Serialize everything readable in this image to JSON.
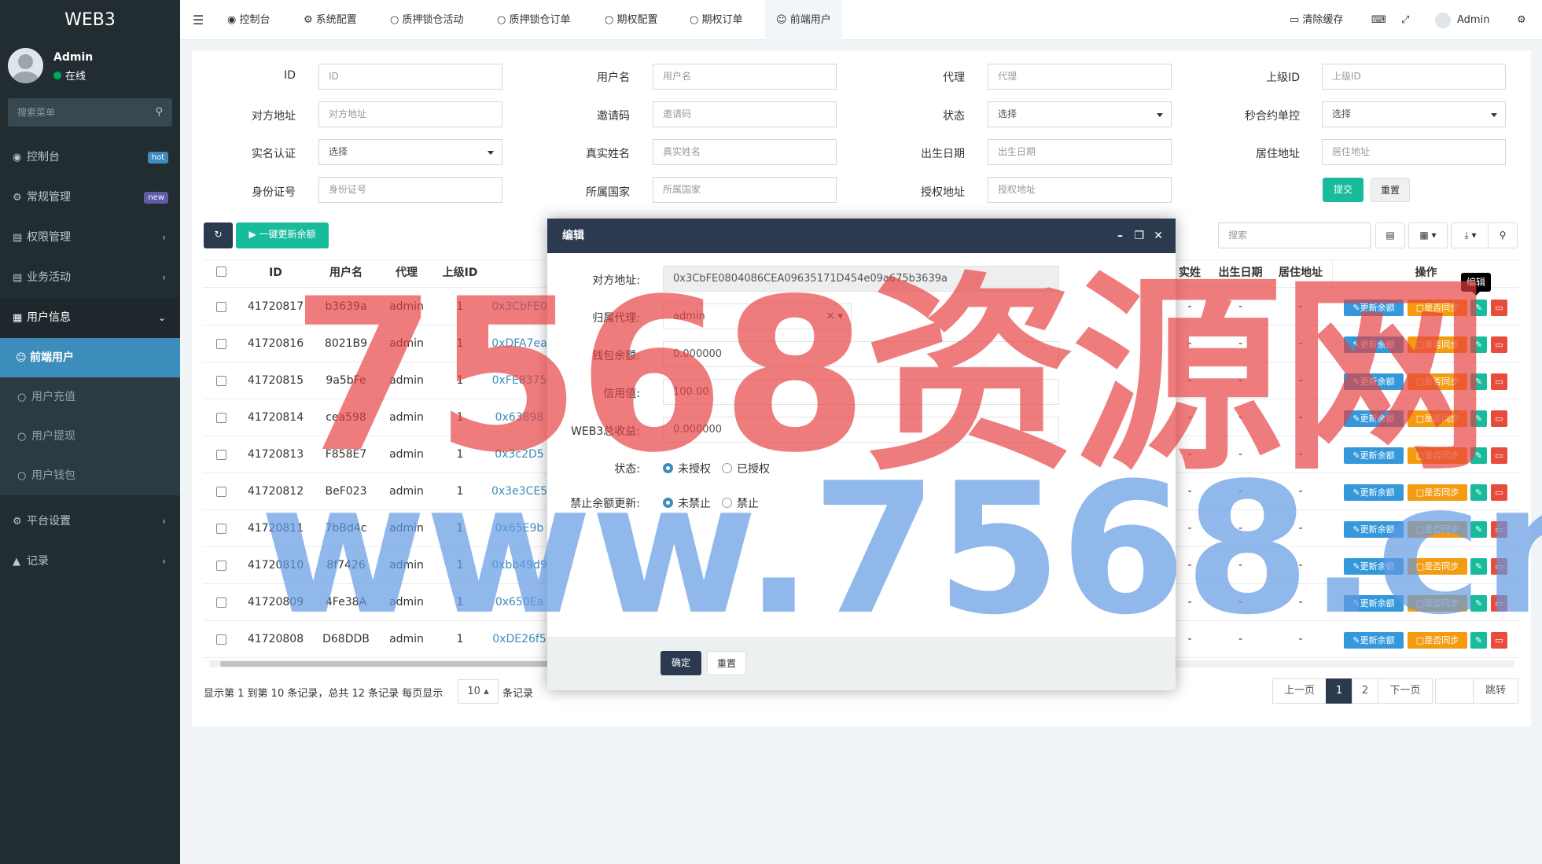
{
  "sidebar": {
    "brand": "WEB3",
    "user": {
      "name": "Admin",
      "status": "在线"
    },
    "search_placeholder": "搜索菜单",
    "items": [
      {
        "label": "控制台",
        "badge": "hot",
        "badge_color": "#3c8dbc"
      },
      {
        "label": "常规管理",
        "badge": "new",
        "badge_color": "#605ca8"
      },
      {
        "label": "权限管理"
      },
      {
        "label": "业务活动"
      },
      {
        "label": "用户信息"
      },
      {
        "label": "前端用户"
      },
      {
        "label": "用户充值"
      },
      {
        "label": "用户提现"
      },
      {
        "label": "用户钱包"
      },
      {
        "label": "平台设置"
      },
      {
        "label": "记录"
      }
    ]
  },
  "topbar": {
    "tabs": [
      "控制台",
      "系统配置",
      "质押锁仓活动",
      "质押锁仓订单",
      "期权配置",
      "期权订单",
      "前端用户"
    ],
    "clear_cache": "清除缓存",
    "admin": "Admin"
  },
  "filters": {
    "id_label": "ID",
    "id_ph": "ID",
    "username_label": "用户名",
    "username_ph": "用户名",
    "agent_label": "代理",
    "agent_ph": "代理",
    "parent_label": "上级ID",
    "parent_ph": "上级ID",
    "addr_label": "对方地址",
    "addr_ph": "对方地址",
    "invite_label": "邀请码",
    "invite_ph": "邀请码",
    "status_label": "状态",
    "status_val": "选择",
    "contract_label": "秒合约单控",
    "contract_val": "选择",
    "realname_auth_label": "实名认证",
    "realname_auth_val": "选择",
    "realname_label": "真实姓名",
    "realname_ph": "真实姓名",
    "birth_label": "出生日期",
    "birth_ph": "出生日期",
    "residence_label": "居住地址",
    "residence_ph": "居住地址",
    "idcard_label": "身份证号",
    "idcard_ph": "身份证号",
    "country_label": "所属国家",
    "country_ph": "所属国家",
    "auth_addr_label": "授权地址",
    "auth_addr_ph": "授权地址",
    "submit": "提交",
    "reset": "重置"
  },
  "toolbar": {
    "update_all": "一键更新余额",
    "search_ph": "搜索"
  },
  "table": {
    "headers": [
      "ID",
      "用户名",
      "代理",
      "上级ID",
      "实姓名",
      "出生日期",
      "居住地址",
      "操作"
    ],
    "rows": [
      {
        "id": "41720817",
        "user": "b3639a",
        "agent": "admin",
        "parent": "1",
        "addr": "0x3CbFE0"
      },
      {
        "id": "41720816",
        "user": "8021B9",
        "agent": "admin",
        "parent": "1",
        "addr": "0xDFA7ea"
      },
      {
        "id": "41720815",
        "user": "9a5bFe",
        "agent": "admin",
        "parent": "1",
        "addr": "0xFE8375"
      },
      {
        "id": "41720814",
        "user": "cea598",
        "agent": "admin",
        "parent": "1",
        "addr": "0x63898"
      },
      {
        "id": "41720813",
        "user": "F858E7",
        "agent": "admin",
        "parent": "1",
        "addr": "0x3c2D5"
      },
      {
        "id": "41720812",
        "user": "BeF023",
        "agent": "admin",
        "parent": "1",
        "addr": "0x3e3CE5"
      },
      {
        "id": "41720811",
        "user": "7bBd4c",
        "agent": "admin",
        "parent": "1",
        "addr": "0x65E9b"
      },
      {
        "id": "41720810",
        "user": "8f7426",
        "agent": "admin",
        "parent": "1",
        "addr": "0xbb49d9"
      },
      {
        "id": "41720809",
        "user": "4Fe38A",
        "agent": "admin",
        "parent": "1",
        "addr": "0x650Ea"
      },
      {
        "id": "41720808",
        "user": "D68DDB",
        "agent": "admin",
        "parent": "1",
        "addr": "0xDE26f5"
      }
    ],
    "dash": "-",
    "actions": {
      "update": "更新余额",
      "sync": "是否同步",
      "tooltip": "编辑"
    }
  },
  "footer": {
    "summary": "显示第 1 到第 10 条记录，总共 12 条记录 每页显示",
    "page_size": "10",
    "records": "条记录",
    "prev": "上一页",
    "p1": "1",
    "p2": "2",
    "next": "下一页",
    "jump": "跳转"
  },
  "modal": {
    "title": "编辑",
    "addr_label": "对方地址:",
    "addr_val": "0x3CbFE0804086CEA09635171D454e09a675b3639a",
    "agent_label": "归属代理:",
    "agent_val": "admin",
    "wallet_label": "钱包余额:",
    "wallet_val": "0.000000",
    "credit_label": "信用值:",
    "credit_val": "100.00",
    "web3_label": "WEB3总收益:",
    "web3_val": "0.000000",
    "status_label": "状态:",
    "status_opt1": "未授权",
    "status_opt2": "已授权",
    "ban_label": "禁止余额更新:",
    "ban_opt1": "未禁止",
    "ban_opt2": "禁止",
    "confirm": "确定",
    "reset": "重置"
  },
  "watermark": {
    "line1": "7568资源网",
    "line2": "www.7568.cn"
  }
}
